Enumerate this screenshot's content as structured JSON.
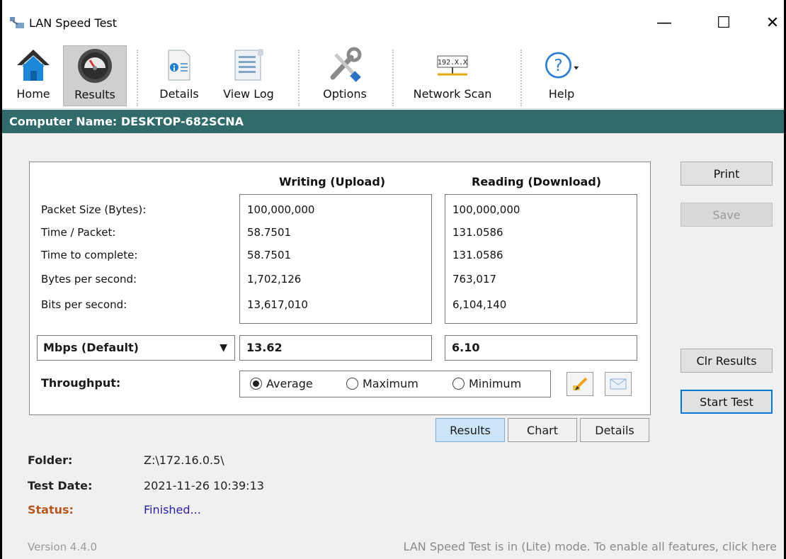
{
  "window": {
    "title": "LAN Speed Test",
    "controls": {
      "minimize": "—",
      "maximize": "☐",
      "close": "✕"
    }
  },
  "toolbar": {
    "items": [
      {
        "label": "Home",
        "icon": "home-icon"
      },
      {
        "label": "Results",
        "icon": "speedometer-icon",
        "active": true
      },
      {
        "label": "Details",
        "icon": "details-icon"
      },
      {
        "label": "View Log",
        "icon": "log-icon"
      },
      {
        "label": "Options",
        "icon": "tools-icon"
      },
      {
        "label": "Network Scan",
        "icon": "network-scan-icon",
        "icon_text": "192.X.X"
      },
      {
        "label": "Help",
        "icon": "help-icon",
        "icon_text": "?"
      }
    ]
  },
  "computer_name": "Computer Name: DESKTOP-682SCNA",
  "results": {
    "upload_header": "Writing (Upload)",
    "download_header": "Reading (Download)",
    "row_labels": [
      "Packet Size (Bytes):",
      "Time / Packet:",
      "Time to complete:",
      "Bytes per second:",
      "Bits per second:"
    ],
    "upload_values": [
      "100,000,000",
      "58.7501",
      "58.7501",
      "1,702,126",
      "13,617,010"
    ],
    "download_values": [
      "100,000,000",
      "131.0586",
      "131.0586",
      "763,017",
      "6,104,140"
    ],
    "unit_select": "Mbps (Default)",
    "upload_rate": "13.62",
    "download_rate": "6.10",
    "throughput_label": "Throughput:",
    "throughput_options": [
      {
        "label": "Average",
        "selected": true
      },
      {
        "label": "Maximum",
        "selected": false
      },
      {
        "label": "Minimum",
        "selected": false
      }
    ]
  },
  "tabs": [
    {
      "label": "Results",
      "active": true
    },
    {
      "label": "Chart",
      "active": false
    },
    {
      "label": "Details",
      "active": false
    }
  ],
  "side_buttons": {
    "print": "Print",
    "save": "Save",
    "clear": "Clr Results",
    "start": "Start Test"
  },
  "info": {
    "folder_label": "Folder:",
    "folder_value": "Z:\\172.16.0.5\\",
    "date_label": "Test Date:",
    "date_value": "2021-11-26 10:39:13",
    "status_label": "Status:",
    "status_value": "Finished..."
  },
  "footer": {
    "version": "Version 4.4.0",
    "lite_message": "LAN Speed Test is in (Lite) mode.  To enable all features, click here"
  },
  "colors": {
    "name_bar": "#316a6a",
    "active_tab": "#cce4f7",
    "status_label": "#b5571e",
    "status_value": "#2a1fa6"
  }
}
